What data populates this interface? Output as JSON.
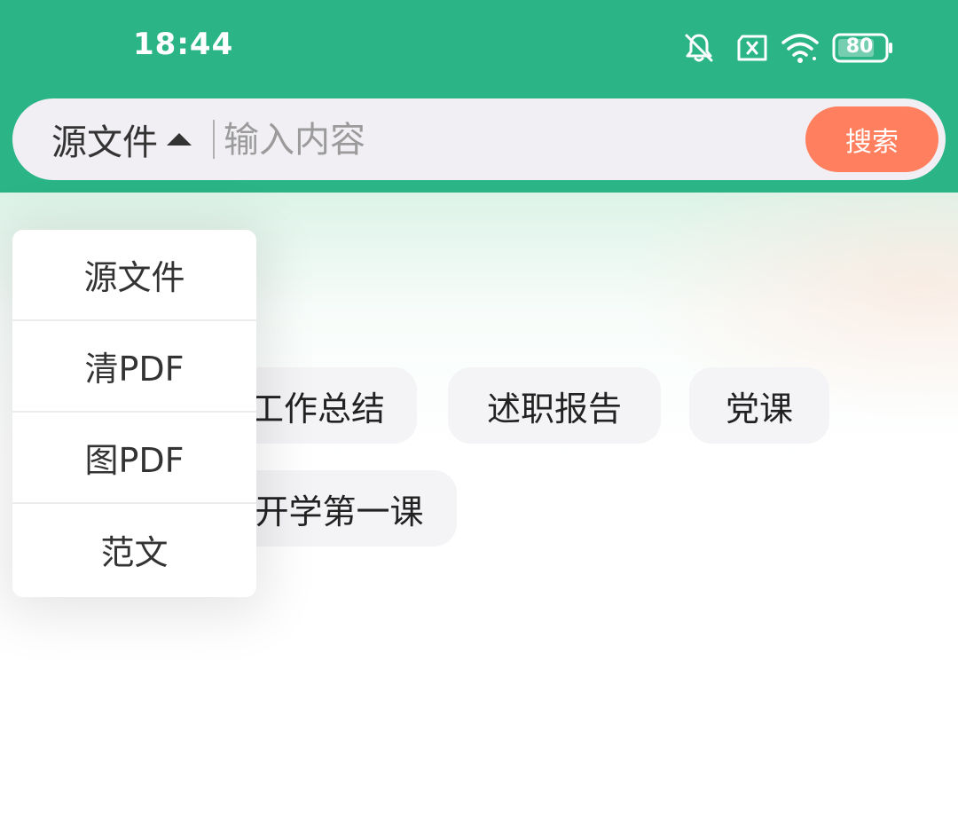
{
  "status_bar": {
    "time": "18:44",
    "battery": "80",
    "icons": [
      "bell-off-icon",
      "no-sim-icon",
      "wifi-icon",
      "battery-icon"
    ]
  },
  "search": {
    "scope": "源文件",
    "placeholder": "输入内容",
    "button_label": "搜索"
  },
  "tags": [
    {
      "label": "工作总结"
    },
    {
      "label": "述职报告"
    },
    {
      "label": "党课"
    },
    {
      "label": "开学第一课"
    }
  ],
  "dropdown": {
    "items": [
      {
        "label": "源文件"
      },
      {
        "label": "清PDF"
      },
      {
        "label": "图PDF"
      },
      {
        "label": "范文"
      }
    ]
  },
  "colors": {
    "header": "#2bb485",
    "search_button": "#ff7f5e",
    "chip_bg": "#f4f3f6"
  }
}
